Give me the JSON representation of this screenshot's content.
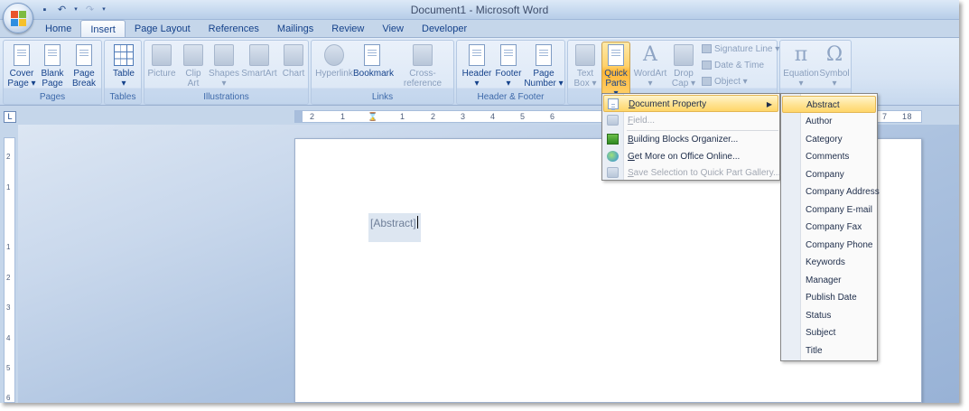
{
  "window": {
    "title": "Document1 - Microsoft Word"
  },
  "tabs": [
    "Home",
    "Insert",
    "Page Layout",
    "References",
    "Mailings",
    "Review",
    "View",
    "Developer"
  ],
  "active_tab": "Insert",
  "ribbon": {
    "pages": {
      "label": "Pages",
      "cover_page": [
        "Cover",
        "Page ▾"
      ],
      "blank_page": [
        "Blank",
        "Page"
      ],
      "page_break": [
        "Page",
        "Break"
      ]
    },
    "tables": {
      "label": "Tables",
      "table": [
        "Table",
        "▾"
      ]
    },
    "illustrations": {
      "label": "Illustrations",
      "picture": "Picture",
      "clip_art": [
        "Clip",
        "Art"
      ],
      "shapes": [
        "Shapes",
        "▾"
      ],
      "smartart": "SmartArt",
      "chart": "Chart"
    },
    "links": {
      "label": "Links",
      "hyperlink": "Hyperlink",
      "bookmark": "Bookmark",
      "cross_reference": "Cross-reference"
    },
    "header_footer": {
      "label": "Header & Footer",
      "header": [
        "Header",
        "▾"
      ],
      "footer": [
        "Footer",
        "▾"
      ],
      "page_number": [
        "Page",
        "Number ▾"
      ]
    },
    "text": {
      "text_box": [
        "Text",
        "Box ▾"
      ],
      "quick_parts": [
        "Quick",
        "Parts ▾"
      ],
      "wordart": [
        "WordArt",
        "▾"
      ],
      "drop_cap": [
        "Drop",
        "Cap ▾"
      ],
      "signature_line": "Signature Line ▾",
      "date_time": "Date & Time",
      "object": "Object ▾"
    },
    "symbols": {
      "equation": [
        "Equation",
        "▾"
      ],
      "symbol": [
        "Symbol",
        "▾"
      ],
      "equation_glyph": "π",
      "symbol_glyph": "Ω"
    }
  },
  "ruler": {
    "corner": "L",
    "h_marks": [
      "2",
      "1",
      "1",
      "2",
      "3",
      "4",
      "5",
      "6",
      "7",
      "18"
    ],
    "v_marks": [
      "2",
      "1",
      "1",
      "2",
      "3",
      "4",
      "5",
      "6"
    ]
  },
  "document": {
    "abstract_field": "[Abstract]"
  },
  "quick_parts_menu": {
    "items": [
      {
        "pre": "",
        "key": "D",
        "post": "ocument Property",
        "state": "highlighted",
        "submenu": true
      },
      {
        "pre": "",
        "key": "F",
        "post": "ield...",
        "state": "disabled"
      },
      {
        "pre": "",
        "key": "B",
        "post": "uilding Blocks Organizer...",
        "state": "normal"
      },
      {
        "pre": "",
        "key": "G",
        "post": "et More on Office Online...",
        "state": "normal"
      },
      {
        "pre": "",
        "key": "S",
        "post": "ave Selection to Quick Part Gallery...",
        "state": "disabled"
      }
    ]
  },
  "document_property_submenu": {
    "items": [
      "Abstract",
      "Author",
      "Category",
      "Comments",
      "Company",
      "Company Address",
      "Company E-mail",
      "Company Fax",
      "Company Phone",
      "Keywords",
      "Manager",
      "Publish Date",
      "Status",
      "Subject",
      "Title"
    ],
    "highlighted": "Abstract"
  },
  "colors": {
    "ribbon_text": "#15428b",
    "highlight": "#ffd669",
    "document_background": "#adc3e0"
  }
}
